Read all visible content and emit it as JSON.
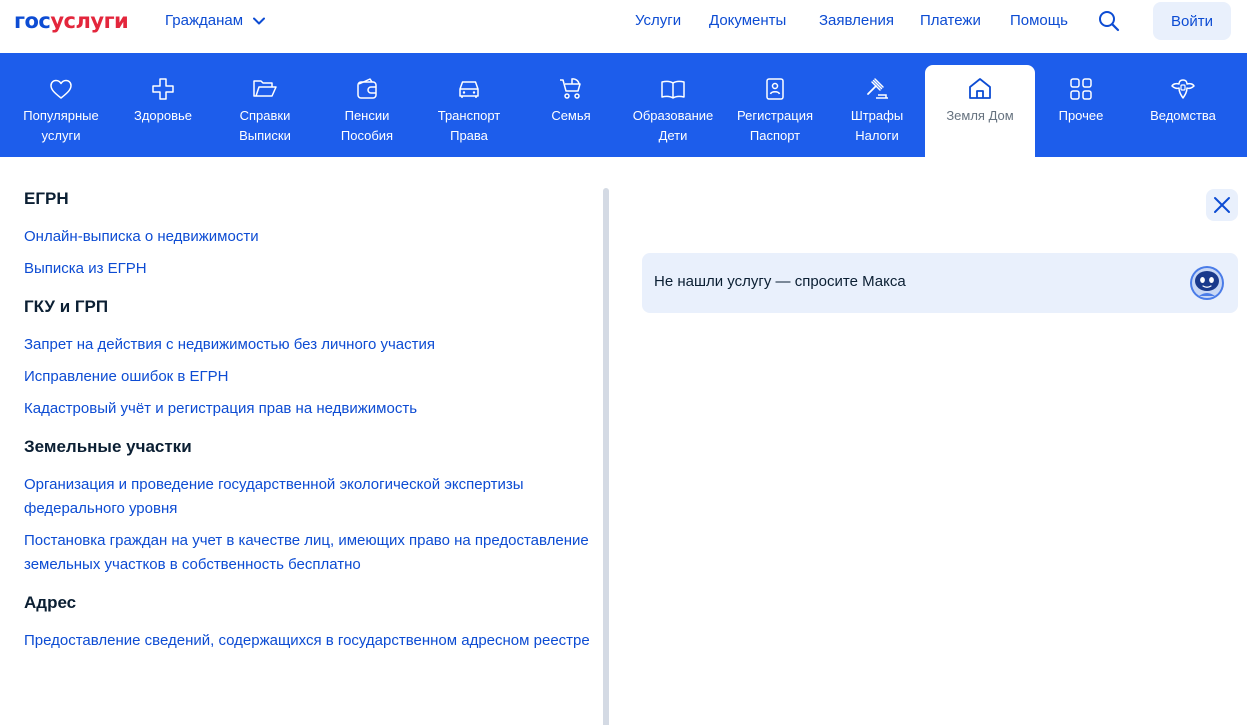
{
  "header": {
    "logo_part1": "гос",
    "logo_part2": "услуги",
    "audience": "Гражданам",
    "nav": [
      "Услуги",
      "Документы",
      "Заявления",
      "Платежи",
      "Помощь"
    ],
    "login": "Войти"
  },
  "categories": [
    {
      "line1": "Популярные",
      "line2": "услуги",
      "icon": "heart-icon"
    },
    {
      "line1": "Здоровье",
      "line2": "",
      "icon": "plus-cross-icon"
    },
    {
      "line1": "Справки",
      "line2": "Выписки",
      "icon": "folder-icon"
    },
    {
      "line1": "Пенсии",
      "line2": "Пособия",
      "icon": "wallet-icon"
    },
    {
      "line1": "Транспорт",
      "line2": "Права",
      "icon": "car-icon"
    },
    {
      "line1": "Семья",
      "line2": "",
      "icon": "stroller-icon"
    },
    {
      "line1": "Образование",
      "line2": "Дети",
      "icon": "book-icon"
    },
    {
      "line1": "Регистрация",
      "line2": "Паспорт",
      "icon": "id-card-icon"
    },
    {
      "line1": "Штрафы",
      "line2": "Налоги",
      "icon": "gavel-icon"
    },
    {
      "line1": "Земля Дом",
      "line2": "",
      "icon": "house-icon"
    },
    {
      "line1": "Прочее",
      "line2": "",
      "icon": "grid-icon"
    },
    {
      "line1": "Ведомства",
      "line2": "",
      "icon": "emblem-icon"
    }
  ],
  "sections": [
    {
      "title": "ЕГРН",
      "links": [
        "Онлайн-выписка о недвижимости",
        "Выписка из ЕГРН"
      ]
    },
    {
      "title": "ГКУ и ГРП",
      "links": [
        "Запрет на действия с недвижимостью без личного участия",
        "Исправление ошибок в ЕГРН",
        "Кадастровый учёт и регистрация прав на недвижимость"
      ]
    },
    {
      "title": "Земельные участки",
      "links": [
        "Организация и проведение государственной экологической экспертизы федерального уровня",
        "Постановка граждан на учет в качестве лиц, имеющих право на предоставление земельных участков в собственность бесплатно"
      ]
    },
    {
      "title": "Адрес",
      "links": [
        "Предоставление сведений, содержащихся в государственном адресном реестре"
      ]
    }
  ],
  "assistant": {
    "text": "Не нашли услугу — спросите Макса"
  },
  "colors": {
    "brand_blue": "#0d4cd3",
    "brand_red": "#e3263c",
    "category_bar": "#1d5deb",
    "light_bg": "#e9f0fc"
  }
}
